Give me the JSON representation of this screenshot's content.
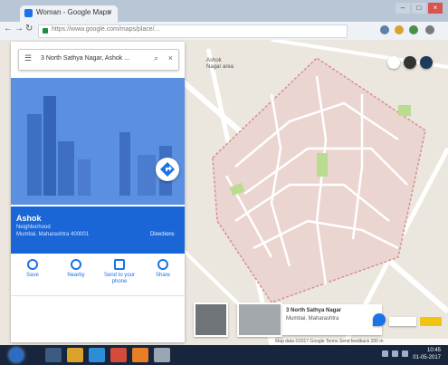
{
  "browser": {
    "tab_title": "Woman - Google Maps",
    "tab_close": "×",
    "window_buttons": [
      "–",
      "□",
      "×"
    ],
    "nav_back": "←",
    "nav_forward": "→",
    "nav_reload": "↻",
    "url": "https://www.google.com/maps/place/..."
  },
  "search": {
    "query": "3 North Sathya Nagar, Ashok ...",
    "menu_icon": "☰",
    "search_icon": "⌕",
    "clear_icon": "×"
  },
  "place": {
    "name": "Ashok",
    "type": "Neighborhood",
    "address": "Mumbai, Maharashtra 400001",
    "directions_label": "Directions"
  },
  "actions": [
    {
      "label": "Save",
      "icon": "bookmark-icon"
    },
    {
      "label": "Nearby",
      "icon": "nearby-icon"
    },
    {
      "label": "Send to your phone",
      "icon": "phone-icon"
    },
    {
      "label": "Share",
      "icon": "share-icon"
    }
  ],
  "map": {
    "area_fill": "#ead5d1",
    "area_border": "#d88f8f",
    "road_color": "#ffffff",
    "park_color": "#b9dc8e",
    "label_top": "Ashok\nNagar area",
    "info_card": {
      "title": "3 North Sathya Nagar",
      "subtitle": "Mumbai, Maharashtra"
    },
    "footer": "Map data ©2017 Google  Terms  Send feedback  200 m"
  },
  "taskbar": {
    "clock_time": "10:45",
    "clock_date": "01-05-2017"
  },
  "colors": {
    "accent": "#1a73e8",
    "panel_blue": "#1a66d6",
    "hero_blue": "#4f84d8",
    "taskbar": "#17263d"
  }
}
